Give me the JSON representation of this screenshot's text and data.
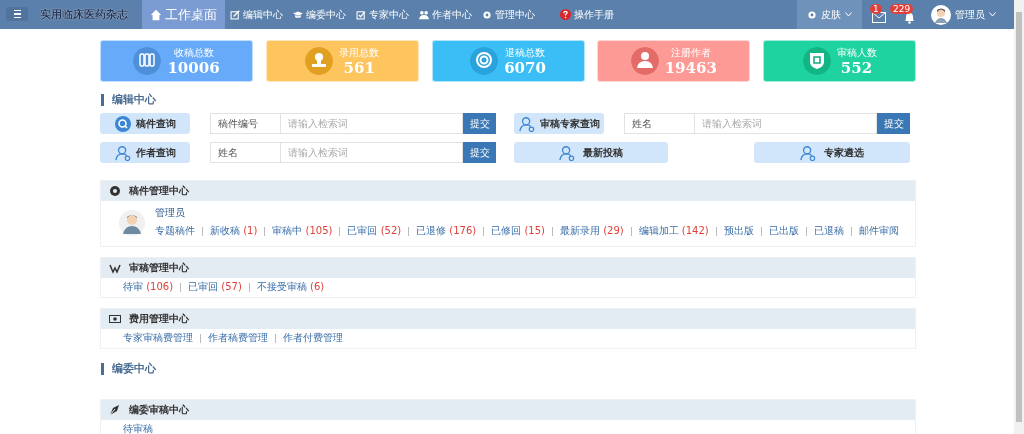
{
  "nav": {
    "brand": "实用临床医药杂志",
    "items": [
      {
        "label": "工作桌面",
        "selected": true
      },
      {
        "label": "编辑中心",
        "selected": false
      },
      {
        "label": "编委中心",
        "selected": false
      },
      {
        "label": "专家中心",
        "selected": false
      },
      {
        "label": "作者中心",
        "selected": false
      },
      {
        "label": "管理中心",
        "selected": false
      }
    ],
    "help": "操作手册",
    "skin": "皮肤",
    "mail_badge": "1",
    "bell_badge": "229",
    "user": "管理员"
  },
  "stats": [
    {
      "label": "收稿总数",
      "value": "10006",
      "color": "#66aaf9"
    },
    {
      "label": "录用总数",
      "value": "561",
      "color": "#fec45e"
    },
    {
      "label": "退稿总数",
      "value": "6070",
      "color": "#3bbdf5"
    },
    {
      "label": "注册作者",
      "value": "19463",
      "color": "#fd9a95"
    },
    {
      "label": "审稿人数",
      "value": "552",
      "color": "#1fd3a0"
    }
  ],
  "editor_center": {
    "heading": "编辑中心",
    "queries": [
      {
        "label": "稿件查询",
        "field": "稿件编号",
        "placeholder": "请输入检索词",
        "submit": "提交"
      },
      {
        "label": "审稿专家查询",
        "field": "姓名",
        "placeholder": "请输入检索词",
        "submit": "提交"
      },
      {
        "label": "作者查询",
        "field": "姓名",
        "placeholder": "请输入检索词",
        "submit": "提交"
      }
    ],
    "quick_buttons": [
      "最新投稿",
      "专家遴选"
    ]
  },
  "panels": [
    {
      "title": "稿件管理中心",
      "user": "管理员",
      "links": [
        {
          "label": "专题稿件"
        },
        {
          "label": "新收稿",
          "count": "(1)"
        },
        {
          "label": "审稿中",
          "count": "(105)"
        },
        {
          "label": "已审回",
          "count": "(52)"
        },
        {
          "label": "已退修",
          "count": "(176)"
        },
        {
          "label": "已修回",
          "count": "(15)"
        },
        {
          "label": "最新录用",
          "count": "(29)"
        },
        {
          "label": "编辑加工",
          "count": "(142)"
        },
        {
          "label": "预出版"
        },
        {
          "label": "已出版"
        },
        {
          "label": "已退稿"
        },
        {
          "label": "邮件审阅"
        }
      ]
    },
    {
      "title": "审稿管理中心",
      "links": [
        {
          "label": "待审",
          "count": "(106)"
        },
        {
          "label": "已审回",
          "count": "(57)"
        },
        {
          "label": "不接受审稿",
          "count": "(6)"
        }
      ]
    },
    {
      "title": "费用管理中心",
      "links": [
        {
          "label": "专家审稿费管理"
        },
        {
          "label": "作者稿费管理"
        },
        {
          "label": "作者付费管理"
        }
      ]
    }
  ],
  "committee": {
    "heading": "编委中心",
    "panels": [
      {
        "title": "编委审稿中心",
        "links": [
          {
            "label": "待审稿"
          }
        ]
      }
    ]
  }
}
